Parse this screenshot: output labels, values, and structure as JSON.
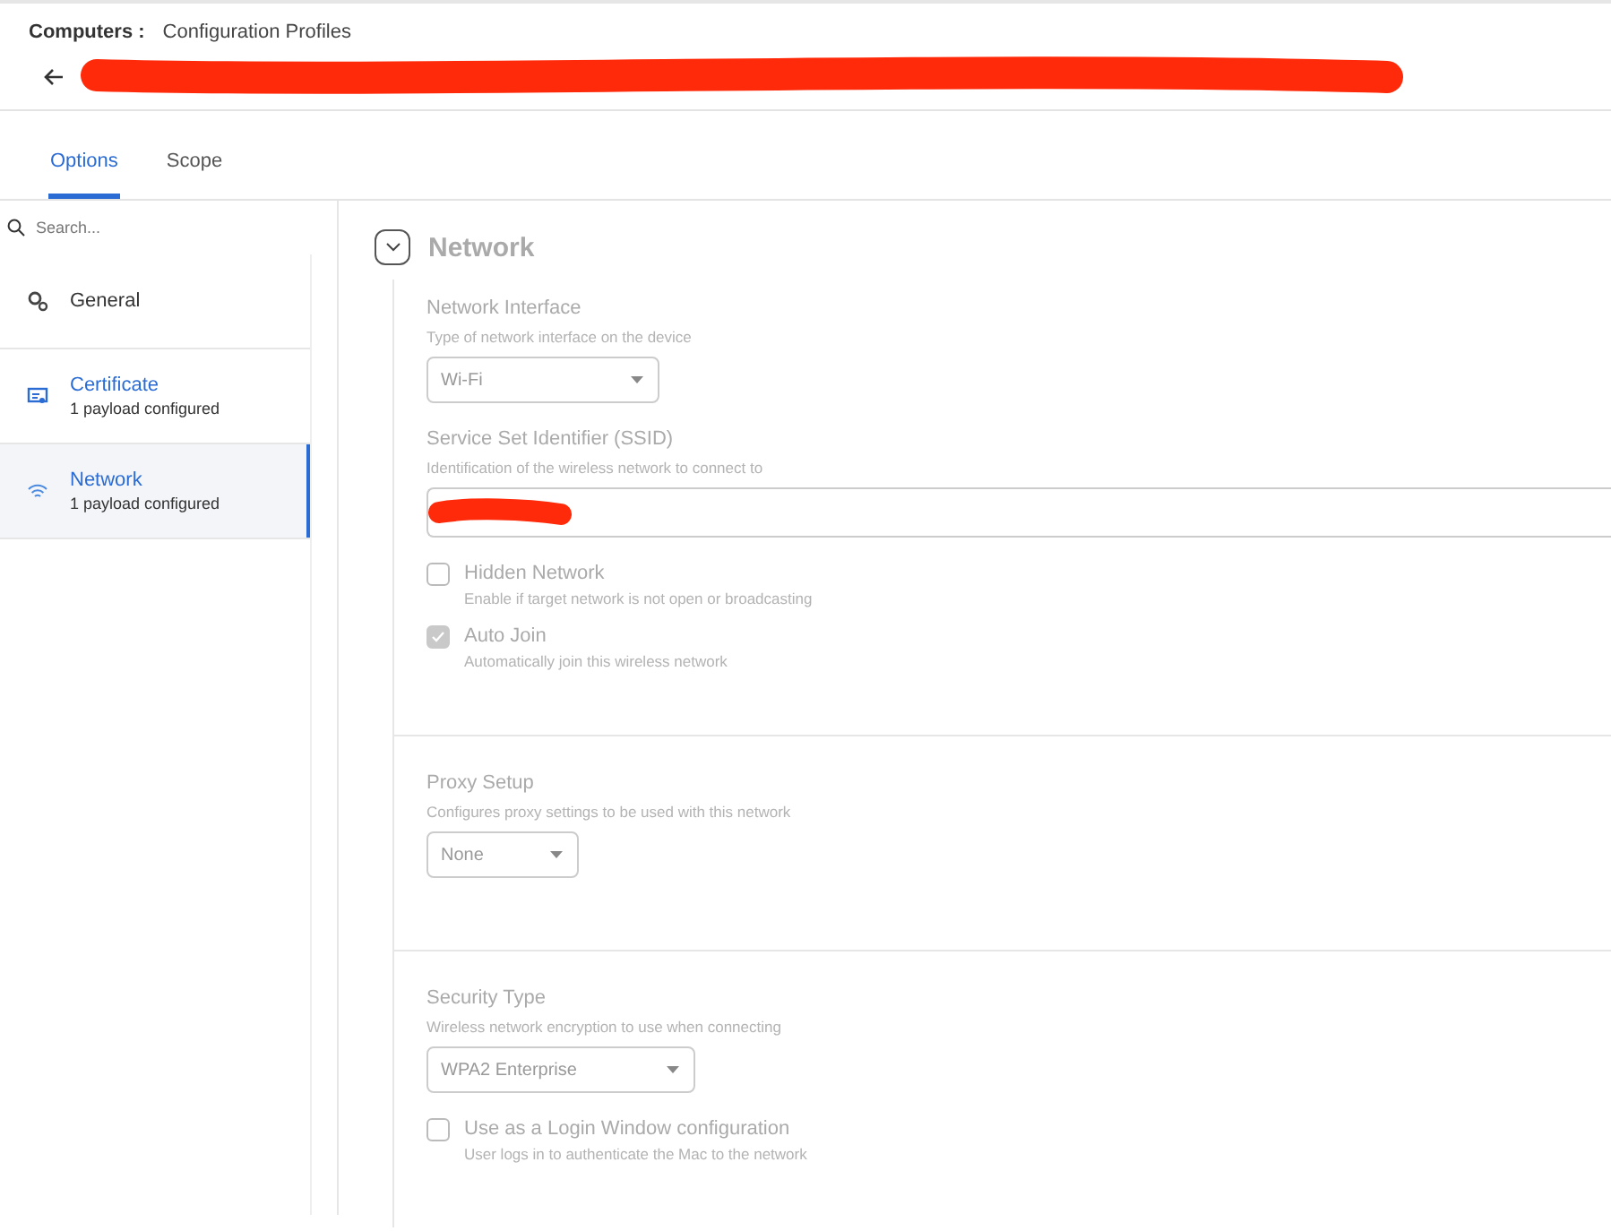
{
  "breadcrumb": {
    "parent": "Computers :",
    "current": "Configuration Profiles"
  },
  "title": {
    "redacted": true
  },
  "tabs": [
    {
      "label": "Options",
      "selected": true
    },
    {
      "label": "Scope",
      "selected": false
    }
  ],
  "search": {
    "placeholder": "Search..."
  },
  "sidebar": {
    "items": [
      {
        "kind": "general",
        "label": "General",
        "selected": false
      },
      {
        "kind": "certificate",
        "label": "Certificate",
        "subtitle": "1 payload configured",
        "selected": false
      },
      {
        "kind": "network",
        "label": "Network",
        "subtitle": "1 payload configured",
        "selected": true
      }
    ]
  },
  "panel": {
    "title": "Network",
    "expanded": true,
    "groups": [
      {
        "fields": [
          {
            "kind": "select",
            "label": "Network Interface",
            "hint": "Type of network interface on the device",
            "value": "Wi-Fi"
          },
          {
            "kind": "text",
            "label": "Service Set Identifier (SSID)",
            "hint": "Identification of the wireless network to connect to",
            "redacted": true
          },
          {
            "kind": "checkbox",
            "label": "Hidden Network",
            "hint": "Enable if target network is not open or broadcasting",
            "checked": false
          },
          {
            "kind": "checkbox",
            "label": "Auto Join",
            "hint": "Automatically join this wireless network",
            "checked": true
          }
        ]
      },
      {
        "fields": [
          {
            "kind": "select",
            "label": "Proxy Setup",
            "hint": "Configures proxy settings to be used with this network",
            "value": "None"
          }
        ]
      },
      {
        "fields": [
          {
            "kind": "select",
            "label": "Security Type",
            "hint": "Wireless network encryption to use when connecting",
            "value": "WPA2 Enterprise"
          },
          {
            "kind": "checkbox",
            "label": "Use as a Login Window configuration",
            "hint": "User logs in to authenticate the Mac to the network",
            "checked": false
          }
        ]
      }
    ]
  }
}
